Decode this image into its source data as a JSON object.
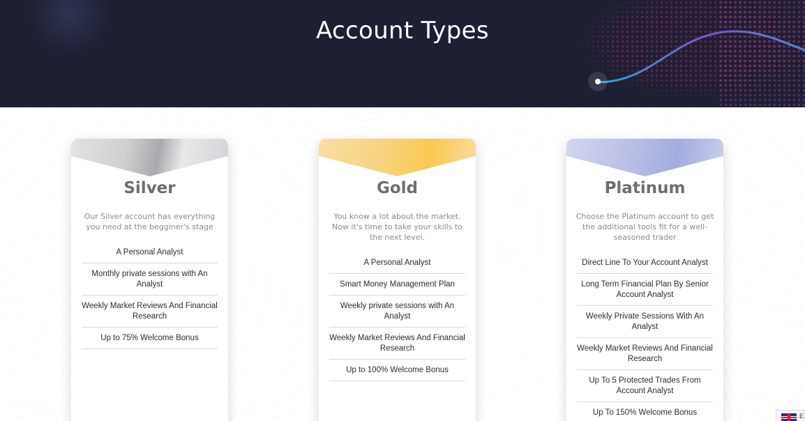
{
  "header": {
    "title": "Account Types"
  },
  "cards": [
    {
      "name": "Silver",
      "description": "Our Silver account has everything you need at the begginer's stage",
      "features": [
        "A Personal Analyst",
        "Monthly private sessions with An Analyst",
        "Weekly Market Reviews And Financial Research",
        "Up to 75% Welcome Bonus"
      ]
    },
    {
      "name": "Gold",
      "description": "You know a lot about the market. Now it's time to take your skills to the next level.",
      "features": [
        "A Personal Analyst",
        "Smart Money Management Plan",
        "Weekly private sessions with An Analyst",
        "Weekly Market Reviews And Financial Research",
        "Up to 100% Welcome Bonus"
      ]
    },
    {
      "name": "Platinum",
      "description": "Choose the Platinum account to get the additional tools fit for a well-seasoned trader",
      "features": [
        "Direct Line To Your Account Analyst",
        "Long Term Financial Plan By Senior Account Analyst",
        "Weekly Private Sessions With An Analyst",
        "Weekly Market Reviews And Financial Research",
        "Up To 5 Protected Trades From Account Analyst",
        "Up To 150% Welcome Bonus"
      ]
    }
  ],
  "language": {
    "icon": "uk-flag-icon",
    "code": "E"
  },
  "colors": {
    "header_bg": "#1d1f33",
    "silver": "#b0b1b4",
    "gold": "#fbc94f",
    "platinum": "#a3acdf"
  }
}
